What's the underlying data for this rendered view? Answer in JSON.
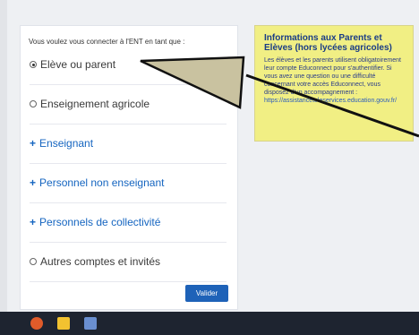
{
  "login": {
    "intro": "Vous voulez vous connecter à l'ENT en tant que :",
    "options": [
      {
        "label": "Elève ou parent",
        "type": "radio",
        "checked": true
      },
      {
        "label": "Enseignement agricole",
        "type": "radio",
        "checked": false
      },
      {
        "label": "Enseignant",
        "type": "expand"
      },
      {
        "label": "Personnel non enseignant",
        "type": "expand"
      },
      {
        "label": "Personnels de collectivité",
        "type": "expand"
      },
      {
        "label": "Autres comptes et invités",
        "type": "radio",
        "checked": false
      }
    ],
    "button": "Valider"
  },
  "info": {
    "title": "Informations aux Parents et Elèves (hors lycées agricoles)",
    "body": "Les élèves et les parents utilisent obligatoirement leur compte Educonnect pour s'authentifier. Si vous avez une question ou une difficulté concernant votre accès Educonnect, vous disposez d'un accompagnement :",
    "link": "https://assistanceteleservices.education.gouv.fr/"
  },
  "taskbar": {
    "icons": [
      "firefox-icon",
      "file-explorer-icon",
      "app-icon"
    ]
  },
  "colors": {
    "accent": "#1e62b8",
    "info_bg": "#f1ef84",
    "info_text": "#1a3c86"
  }
}
